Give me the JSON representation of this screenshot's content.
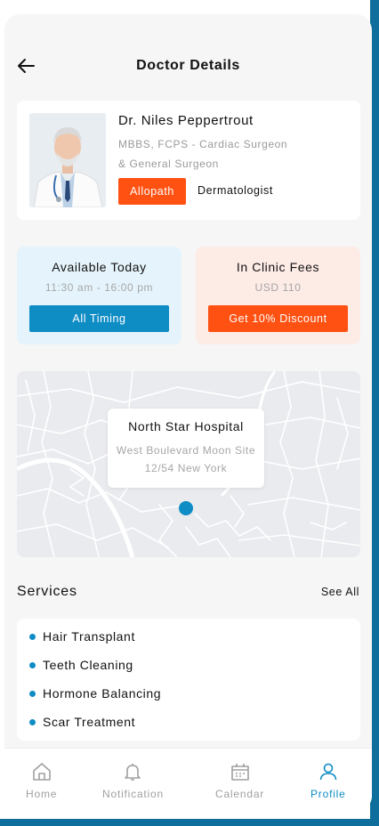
{
  "header": {
    "title": "Doctor Details",
    "back_icon": "arrow-left-icon"
  },
  "doctor": {
    "name": "Dr. Niles Peppertrout",
    "qualification": "MBBS, FCPS - Cardiac Surgeon & General Surgeon",
    "tags": [
      "Allopath",
      "Dermatologist"
    ]
  },
  "availability": {
    "title": "Available Today",
    "hours": "11:30 am - 16:00 pm",
    "button": "All Timing"
  },
  "fees": {
    "title": "In Clinic Fees",
    "amount": "USD 110",
    "button": "Get 10% Discount"
  },
  "map": {
    "place": "North Star Hospital",
    "address": "West Boulevard Moon Site 12/54 New York"
  },
  "services": {
    "title": "Services",
    "see_all": "See All",
    "items": [
      "Hair Transplant",
      "Teeth Cleaning",
      "Hormone Balancing",
      "Scar Treatment"
    ]
  },
  "nav": {
    "items": [
      {
        "label": "Home",
        "icon": "home-icon"
      },
      {
        "label": "Notification",
        "icon": "bell-icon"
      },
      {
        "label": "Calendar",
        "icon": "calendar-icon"
      },
      {
        "label": "Profile",
        "icon": "user-icon"
      }
    ],
    "active": "Profile"
  },
  "colors": {
    "accent_blue": "#0e8cc4",
    "accent_orange": "#ff5112",
    "avail_bg": "#e5f4fc",
    "fees_bg": "#fdebe6",
    "frame": "#0f6e9b"
  }
}
